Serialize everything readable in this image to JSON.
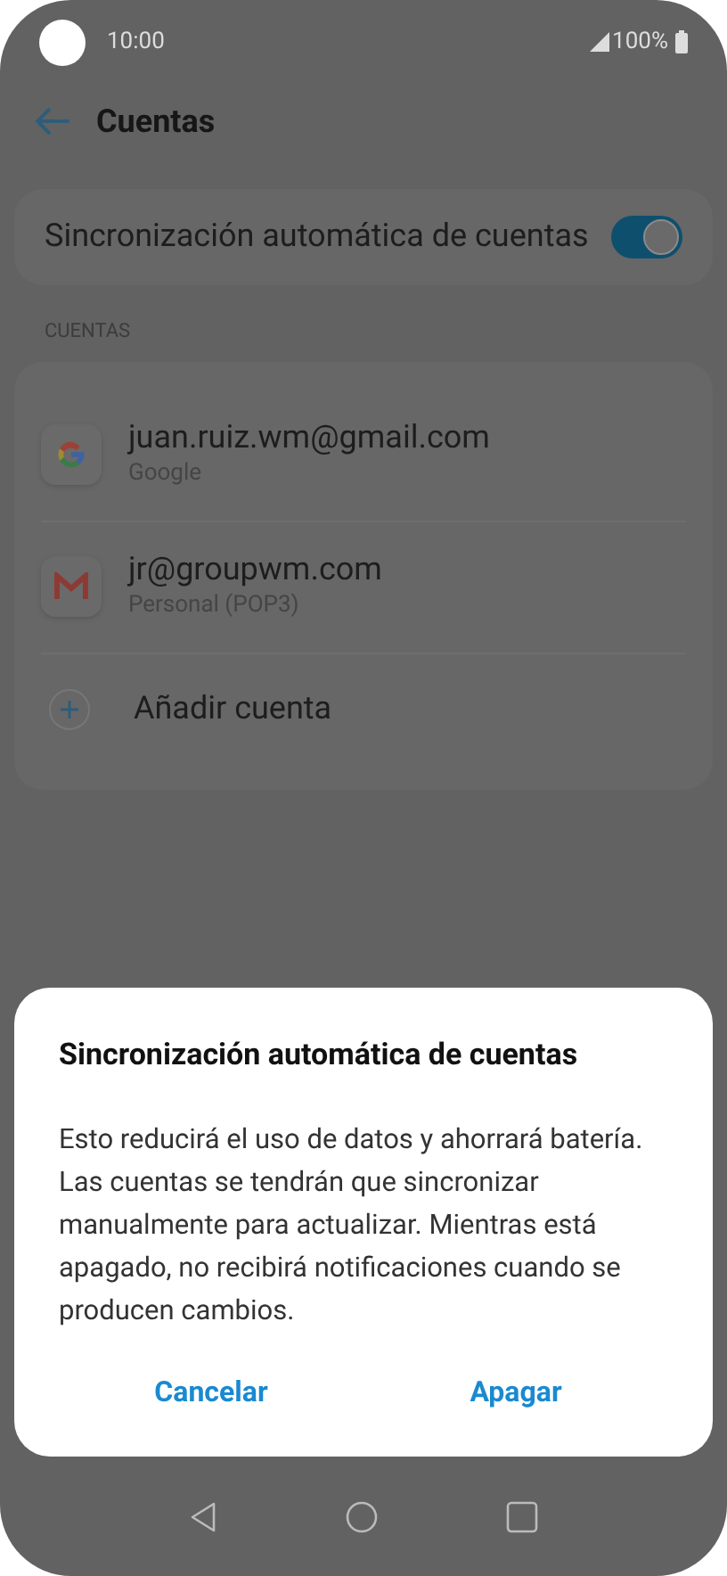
{
  "status_bar": {
    "time": "10:00",
    "battery": "100%"
  },
  "header": {
    "title": "Cuentas"
  },
  "sync_setting": {
    "label": "Sincronización automática de cuentas",
    "on": true
  },
  "section_label": "CUENTAS",
  "accounts": [
    {
      "kind": "google",
      "email": "juan.ruiz.wm@gmail.com",
      "type": "Google"
    },
    {
      "kind": "mail",
      "email": "jr@groupwm.com",
      "type": "Personal (POP3)"
    }
  ],
  "add_account": "Añadir cuenta",
  "dialog": {
    "title": "Sincronización automática de cuentas",
    "message": "Esto reducirá el uso de datos y ahorrará batería. Las cuentas se tendrán que sincronizar manualmente para actualizar. Mientras está apagado, no recibirá notificaciones cuando se producen cambios.",
    "buttons": [
      "Cancelar",
      "Apagar"
    ]
  }
}
